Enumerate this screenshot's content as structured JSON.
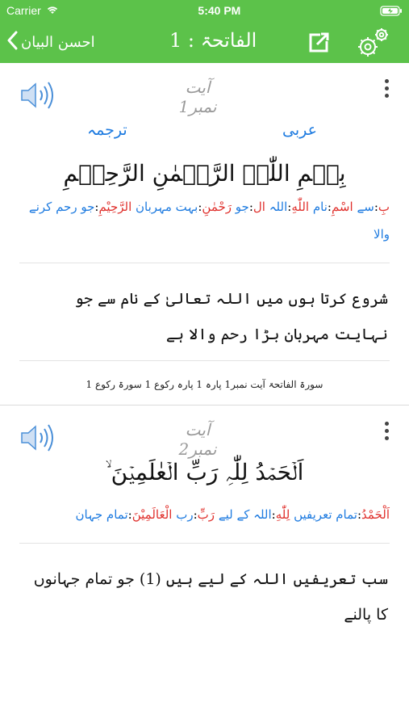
{
  "status_bar": {
    "carrier": "Carrier",
    "time": "5:40 PM"
  },
  "nav": {
    "back_label": "احسن البیان",
    "title": "الفاتحۃ : 1"
  },
  "ayahs": [
    {
      "label": "آیت نمبر1",
      "toggle": {
        "translation": "ترجمہ",
        "arabic": "عربی"
      },
      "arabic": "بِسۡمِ اللّٰہِ الرَّحۡمٰنِ الرَّحِیۡمِ",
      "words": [
        {
          "ar": "بِ",
          "ur": "سے"
        },
        {
          "ar": "اسْمِ",
          "ur": "نام"
        },
        {
          "ar": "اللّٰهِ",
          "ur": "اللہ"
        },
        {
          "ar": "ال",
          "ur": "جو"
        },
        {
          "ar": "رَحْمٰنِ",
          "ur": "بہت مہربان"
        },
        {
          "ar": "الرَّحِيْمِ",
          "ur": "جو رحم کرنے والا"
        }
      ],
      "translation": "شروع کرتا ہوں میں اللہ تعالیٰ کے نام سے جو نہایت مہربان بڑا رحم والا ہے",
      "reference": "سورۃ الفاتحۃ آیت نمبر1  پارہ 1  پارہ رکوع 1  سورۃ رکوع 1"
    },
    {
      "label": "آیت نمبر2",
      "arabic": "اَلۡحَمۡدُ لِلّٰہِ رَبِّ الۡعٰلَمِیۡنَ ۙ",
      "words": [
        {
          "ar": "اَلْحَمْدُ",
          "ur": "تمام تعریفیں"
        },
        {
          "ar": "لِلّٰهِ",
          "ur": "اللہ کے لیے"
        },
        {
          "ar": "رَبِّ",
          "ur": "رب"
        },
        {
          "ar": "الْعَالَمِيْنَ",
          "ur": "تمام جہان"
        }
      ],
      "translation_partial": "سب تعریفیں اللہ کے لیے ہیں (1) جو تمام جہانوں کا پالنے"
    }
  ]
}
